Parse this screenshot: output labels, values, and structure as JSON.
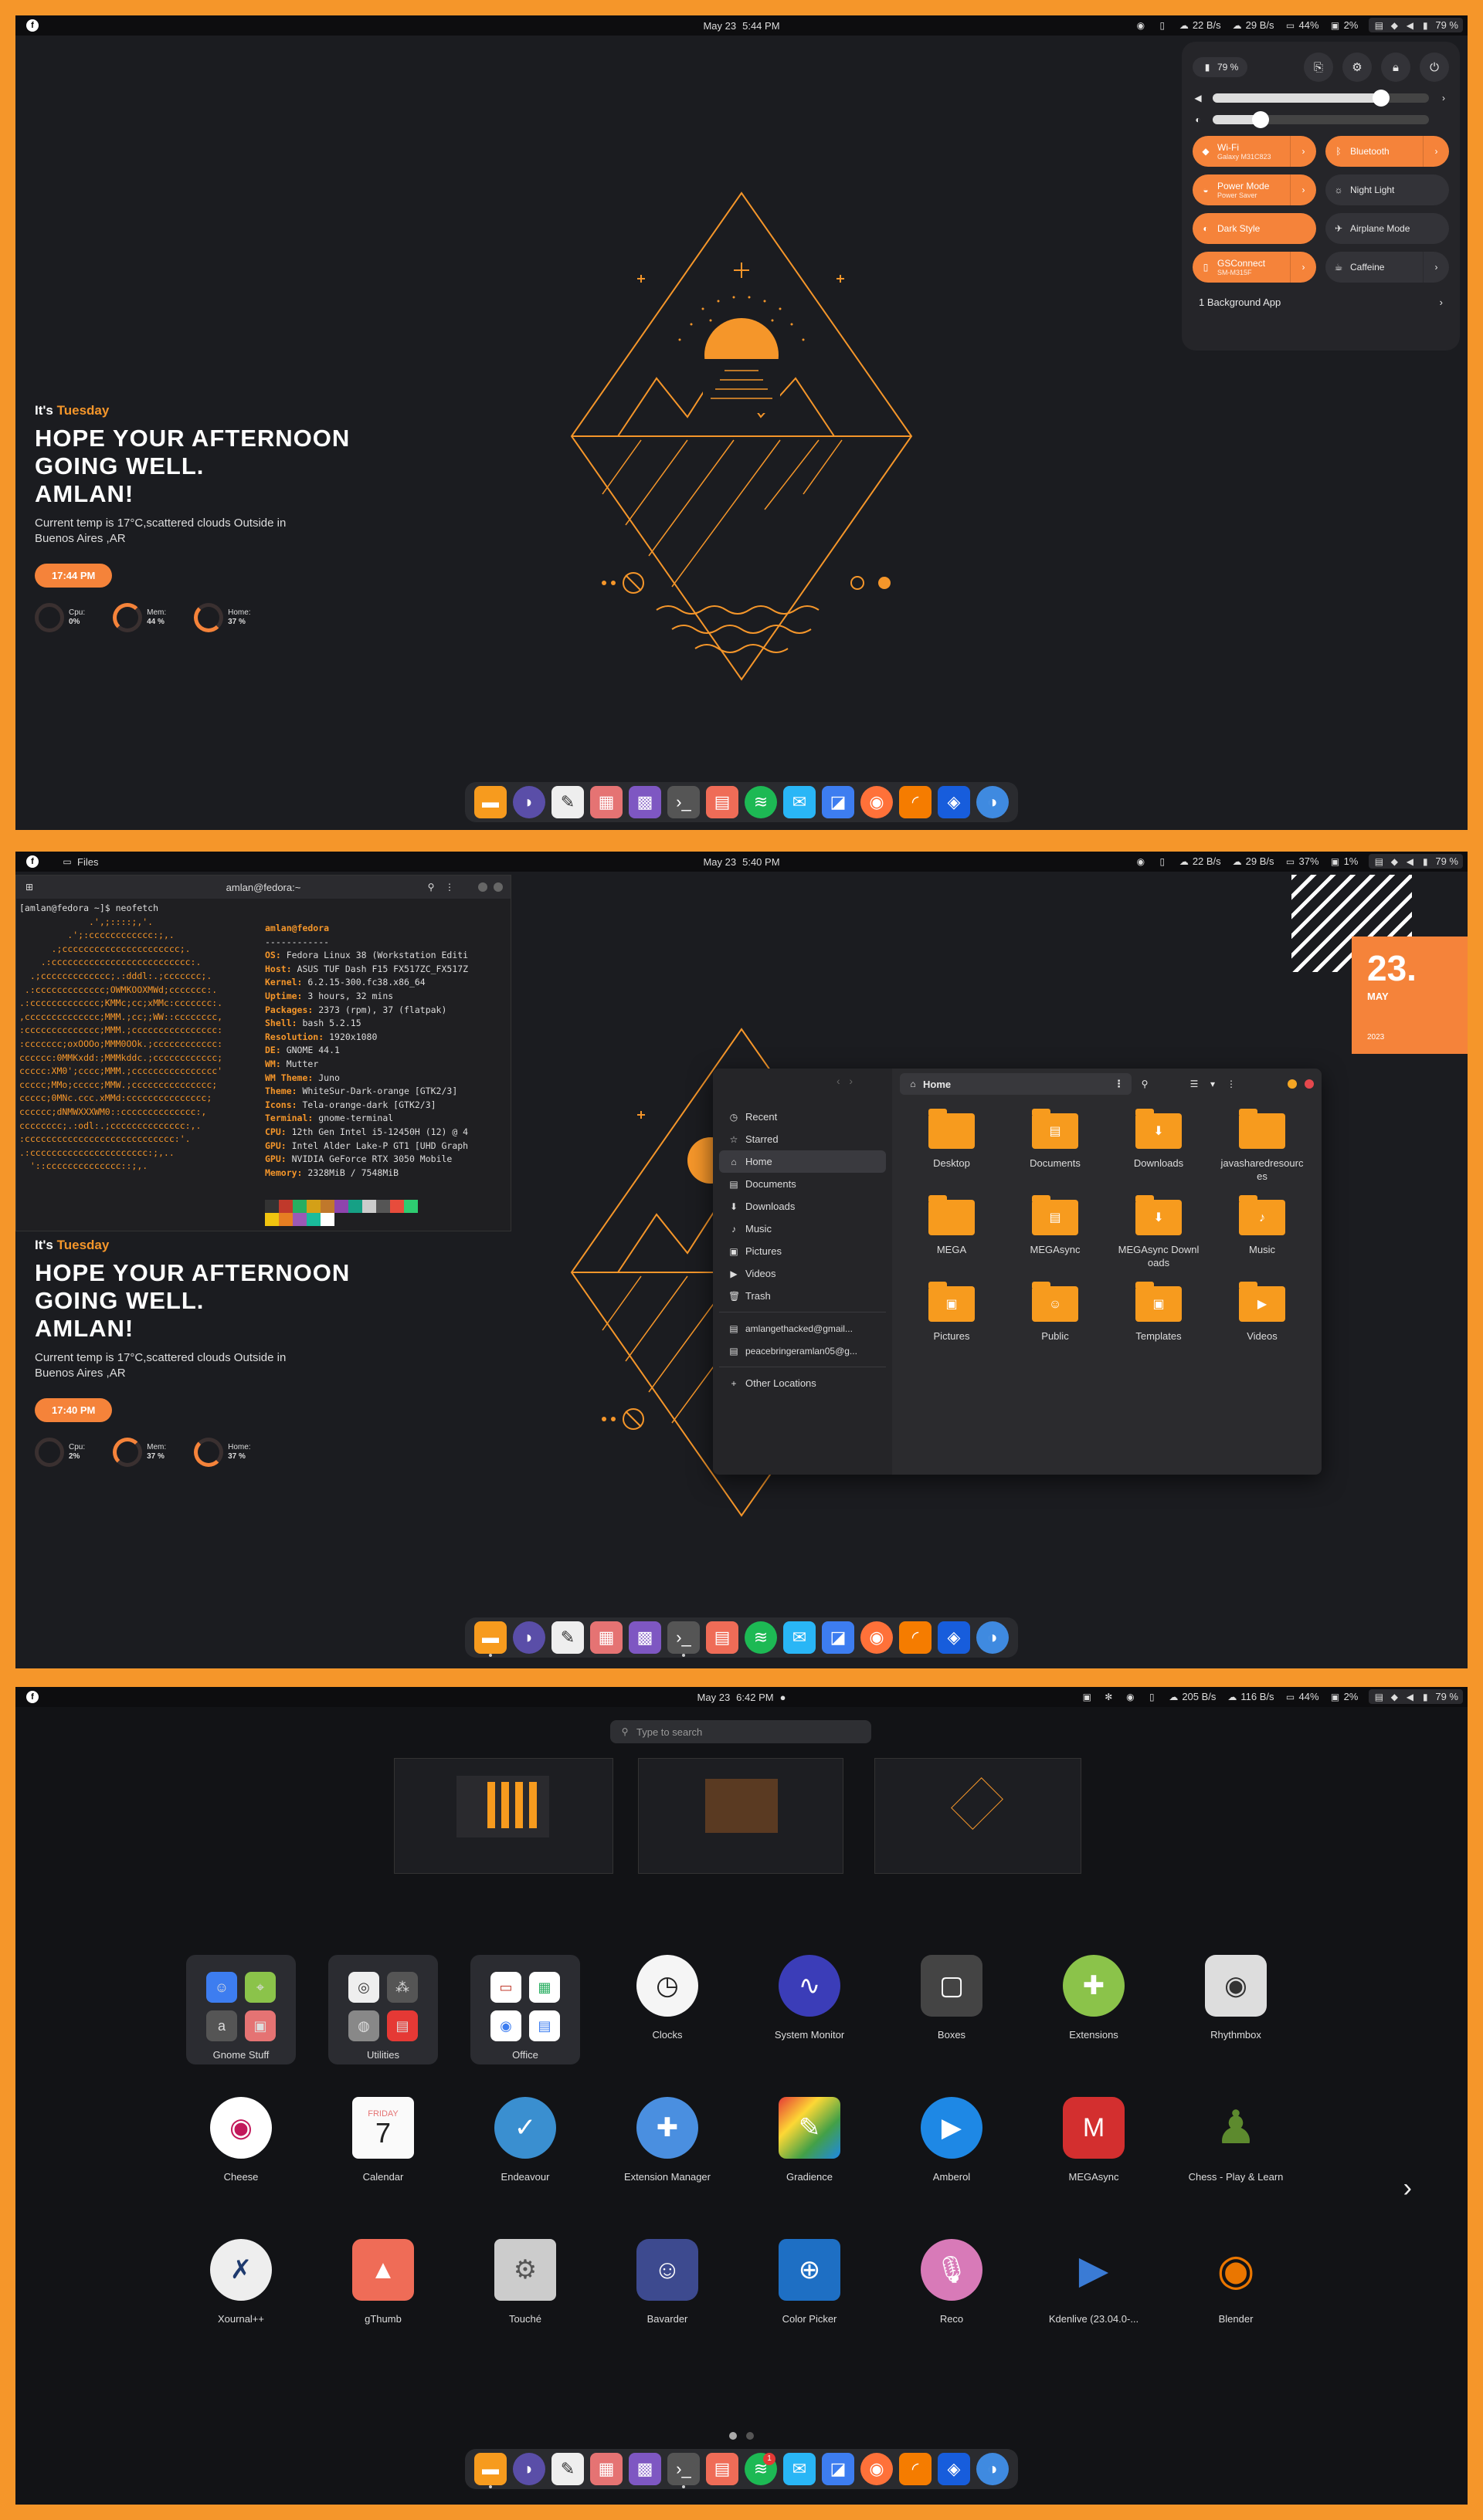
{
  "colors": {
    "accent": "#f5833a",
    "folder": "#f79b1e",
    "frame": "#f5962a",
    "bg": "#1b1c20"
  },
  "screen1": {
    "topbar": {
      "date": "May 23",
      "time": "5:44 PM",
      "down": "22 B/s",
      "up": "29 B/s",
      "cpu": "44%",
      "mem": "2%",
      "battery": "79 %"
    },
    "widget": {
      "its": "It's",
      "day": "Tuesday",
      "greeting": "HOPE YOUR AFTERNOON\nGOING WELL.\nAMLAN!",
      "temp": "Current temp is 17°C,scattered clouds Outside in Buenos Aires ,AR",
      "clock": "17:44 PM",
      "cpu_label": "Cpu:",
      "cpu_value": "0%",
      "mem_label": "Mem:",
      "mem_value": "44 %",
      "home_label": "Home:",
      "home_value": "37 %"
    },
    "quick_settings": {
      "battery": "79 %",
      "volume_level": 0.78,
      "brightness_level": 0.22,
      "wifi": {
        "label": "Wi-Fi",
        "sub": "Galaxy M31C823"
      },
      "bluetooth": {
        "label": "Bluetooth"
      },
      "power": {
        "label": "Power Mode",
        "sub": "Power Saver"
      },
      "night": {
        "label": "Night Light"
      },
      "dark": {
        "label": "Dark Style"
      },
      "airplane": {
        "label": "Airplane Mode"
      },
      "gsconnect": {
        "label": "GSConnect",
        "sub": "SM-M315F"
      },
      "caffeine": {
        "label": "Caffeine"
      },
      "background_apps": "1 Background App"
    }
  },
  "screen2": {
    "topbar": {
      "app": "Files",
      "date": "May 23",
      "time": "5:40 PM",
      "down": "22 B/s",
      "up": "29 B/s",
      "cpu": "37%",
      "mem": "1%",
      "battery": "79 %"
    },
    "terminal": {
      "title": "amlan@fedora:~",
      "prompt": "[amlan@fedora ~]$ neofetch",
      "user": "amlan@fedora",
      "sep": "------------",
      "lines": [
        [
          "OS:",
          " Fedora Linux 38 (Workstation Editi"
        ],
        [
          "Host:",
          " ASUS TUF Dash F15 FX517ZC_FX517Z"
        ],
        [
          "Kernel:",
          " 6.2.15-300.fc38.x86_64"
        ],
        [
          "Uptime:",
          " 3 hours, 32 mins"
        ],
        [
          "Packages:",
          " 2373 (rpm), 37 (flatpak)"
        ],
        [
          "Shell:",
          " bash 5.2.15"
        ],
        [
          "Resolution:",
          " 1920x1080"
        ],
        [
          "DE:",
          " GNOME 44.1"
        ],
        [
          "WM:",
          " Mutter"
        ],
        [
          "WM Theme:",
          " Juno"
        ],
        [
          "Theme:",
          " WhiteSur-Dark-orange [GTK2/3]"
        ],
        [
          "Icons:",
          " Tela-orange-dark [GTK2/3]"
        ],
        [
          "Terminal:",
          " gnome-terminal"
        ],
        [
          "CPU:",
          " 12th Gen Intel i5-12450H (12) @ 4"
        ],
        [
          "GPU:",
          " Intel Alder Lake-P GT1 [UHD Graph"
        ],
        [
          "GPU:",
          " NVIDIA GeForce RTX 3050 Mobile"
        ],
        [
          "Memory:",
          " 2328MiB / 7548MiB"
        ]
      ],
      "ascii": "             .',;::::;,'.\n         .';:cccccccccccc:;,.\n      .;cccccccccccccccccccccc;.\n    .:cccccccccccccccccccccccccc:.\n  .;ccccccccccccc;.:dddl:.;ccccccc;.\n .:ccccccccccccc;OWMKOOXMWd;ccccccc:.\n.:ccccccccccccc;KMMc;cc;xMMc:ccccccc:.\n,cccccccccccccc;MMM.;cc;;WW::cccccccc,\n:cccccccccccccc;MMM.;cccccccccccccccc:\n:ccccccc;oxOOOo;MMM0OOk.;cccccccccccc:\ncccccc:0MMKxdd:;MMMkddc.;cccccccccccc;\nccccc:XM0';cccc;MMM.;cccccccccccccccc'\nccccc;MMo;ccccc;MMW.;ccccccccccccccc;\nccccc;0MNc.ccc.xMMd:ccccccccccccccc;\ncccccc;dNMWXXXWM0::cccccccccccccc:,\ncccccccc;.:odl:.;cccccccccccccc:,.\n:cccccccccccccccccccccccccccc:'.\n.:cccccccccccccccccccccc:;,..\n  '::cccccccccccccc::;,."
    },
    "calendar": {
      "day": "23.",
      "month": "MAY",
      "year": "2023"
    },
    "widget": {
      "its": "It's",
      "day": "Tuesday",
      "greeting": "HOPE YOUR AFTERNOON\nGOING WELL.\nAMLAN!",
      "temp": "Current temp is 17°C,scattered clouds Outside in Buenos Aires ,AR",
      "clock": "17:40 PM",
      "cpu_label": "Cpu:",
      "cpu_value": "2%",
      "mem_label": "Mem:",
      "mem_value": "37 %",
      "home_label": "Home:",
      "home_value": "37 %"
    },
    "files": {
      "path": "Home",
      "sidebar": [
        "Recent",
        "Starred",
        "Home",
        "Documents",
        "Downloads",
        "Music",
        "Pictures",
        "Videos",
        "Trash"
      ],
      "accounts": [
        "amlangethacked@gmail...",
        "peacebringeramlan05@g..."
      ],
      "other": "Other Locations",
      "items": [
        "Desktop",
        "Documents",
        "Downloads",
        "javasharedresources",
        "MEGA",
        "MEGAsync",
        "MEGAsync Downloads",
        "Music",
        "Pictures",
        "Public",
        "Templates",
        "Videos"
      ]
    }
  },
  "screen3": {
    "topbar": {
      "date": "May 23",
      "time": "6:42 PM",
      "down": "205 B/s",
      "up": "116 B/s",
      "cpu": "44%",
      "mem": "2%",
      "battery": "79 %"
    },
    "search_placeholder": "Type to search",
    "folders": [
      {
        "name": "Gnome Stuff"
      },
      {
        "name": "Utilities"
      },
      {
        "name": "Office"
      }
    ],
    "row1": [
      "Clocks",
      "System Monitor",
      "Boxes",
      "Extensions",
      "Rhythmbox"
    ],
    "row2": [
      "Cheese",
      "Calendar",
      "Endeavour",
      "Extension Manager",
      "Gradience",
      "Amberol",
      "MEGAsync",
      "Chess - Play & Learn"
    ],
    "row3": [
      "Xournal++",
      "gThumb",
      "Touché",
      "Bavarder",
      "Color Picker",
      "Reco",
      "Kdenlive (23.04.0-...",
      "Blender"
    ],
    "calendar_icon": {
      "weekday": "FRIDAY",
      "day": "7"
    },
    "spotify_badge": "1"
  }
}
